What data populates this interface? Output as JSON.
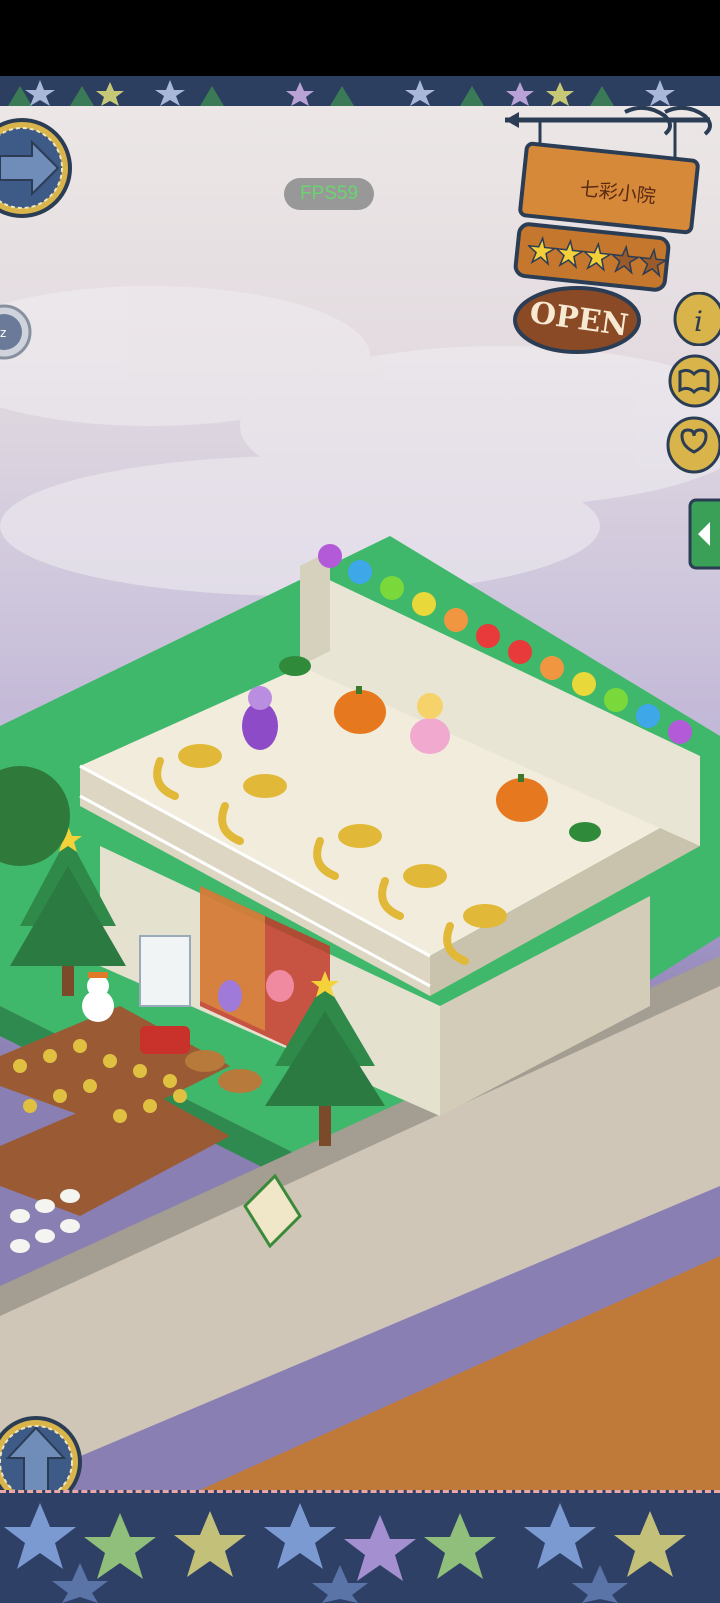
{
  "hud": {
    "fps_label": "FPS59",
    "shop_name": "七彩小院",
    "open_label": "OPEN",
    "rating_stars": 3.5,
    "rating_max": 5
  },
  "icons": {
    "nav_forward": "arrow-right-icon",
    "nav_up": "arrow-up-icon",
    "sleep": "sleep-zz-icon",
    "info": "info-icon",
    "guide": "book-icon",
    "social": "heart-chat-icon",
    "panel_toggle": "chevron-left-icon"
  },
  "colors": {
    "accent_gold": "#d8b44a",
    "wood": "#c4772d",
    "border_navy": "#2c3f60",
    "grass": "#3fb86b",
    "fps_text": "#52d35a"
  }
}
